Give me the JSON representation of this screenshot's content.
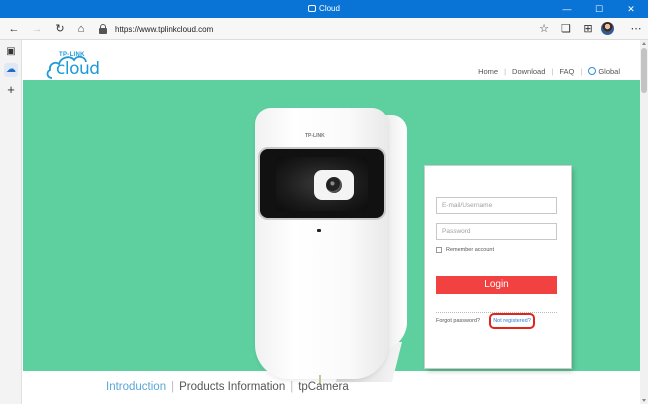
{
  "window": {
    "title": "Cloud",
    "controls": {
      "minimize": "—",
      "maximize": "☐",
      "close": "✕"
    }
  },
  "navbar": {
    "back": "←",
    "forward": "→",
    "reload": "↻",
    "home": "⌂",
    "url": "https://www.tplinkcloud.com",
    "right_icons": {
      "favorite": "☆",
      "collections": "❏",
      "extensions": "⊞",
      "menu": "⋯"
    }
  },
  "sidebar": {
    "tabs_icon": "▣",
    "active_tab_icon": "☁",
    "add": "+"
  },
  "site": {
    "logo_top": "TP-LINK",
    "logo_main": "cloud",
    "nav": [
      "Home",
      "Download",
      "FAQ",
      "Global"
    ],
    "camera_brand": "TP-LINK"
  },
  "login": {
    "email_placeholder": "E-mail/Username",
    "password_placeholder": "Password",
    "remember_label": "Remember account",
    "login_label": "Login",
    "forgot_label": "Forgot password?",
    "notregistered_label": "Not registered?"
  },
  "bottom_nav": {
    "items": [
      "Introduction",
      "Products Information",
      "tpCamera"
    ]
  },
  "colors": {
    "hero_green": "#5ed0a0",
    "login_red": "#f24141",
    "link_blue": "#2a7fd4",
    "titlebar_blue": "#0a74d6",
    "highlight_red": "#e1251b"
  }
}
